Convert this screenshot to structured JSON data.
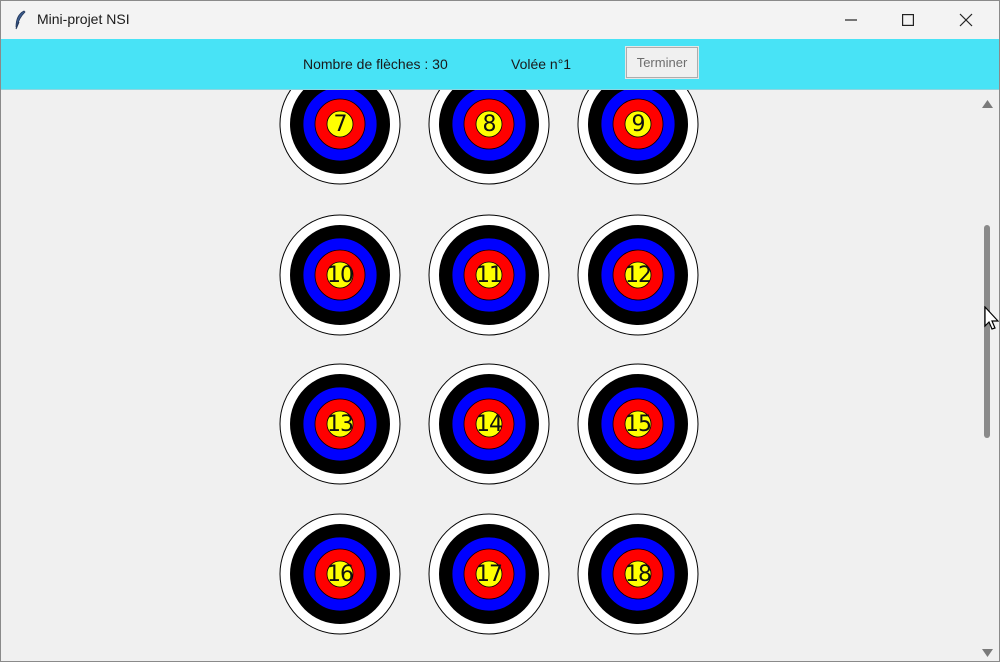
{
  "window": {
    "title": "Mini-projet NSI",
    "icon": "feather-icon",
    "controls": [
      "minimize-icon",
      "maximize-icon",
      "close-icon"
    ]
  },
  "toolbar": {
    "arrow_count_label": "Nombre de flèches : 30",
    "volley_label": "Volée n°1",
    "finish_button_label": "Terminer",
    "background_color": "#48e3f6"
  },
  "targets": [
    {
      "label": "7"
    },
    {
      "label": "8"
    },
    {
      "label": "9"
    },
    {
      "label": "10"
    },
    {
      "label": "11"
    },
    {
      "label": "12"
    },
    {
      "label": "13"
    },
    {
      "label": "14"
    },
    {
      "label": "15"
    },
    {
      "label": "16"
    },
    {
      "label": "17"
    },
    {
      "label": "18"
    }
  ],
  "target_colors": {
    "outer": "#ffffff",
    "ring2": "#000000",
    "ring3": "#0000ff",
    "ring4": "#ff0000",
    "center": "#ffff00"
  },
  "scrollbar": {
    "icons": [
      "scroll-up-arrow-icon",
      "scroll-down-arrow-icon"
    ]
  }
}
